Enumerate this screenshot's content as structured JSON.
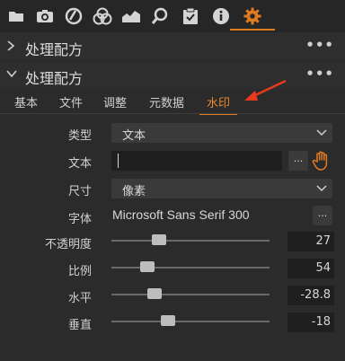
{
  "toolbar": {
    "icons": [
      "folder-icon",
      "camera-icon",
      "lens-icon",
      "color-icon",
      "exposure-icon",
      "search-icon",
      "clipboard-icon",
      "info-icon",
      "gear-icon"
    ],
    "active_color": "#e07b22"
  },
  "sections": [
    {
      "title": "处理配方",
      "expanded": false,
      "more": "•••"
    },
    {
      "title": "处理配方",
      "expanded": true,
      "more": "•••"
    }
  ],
  "tabs": [
    {
      "label": "基本"
    },
    {
      "label": "文件"
    },
    {
      "label": "调整"
    },
    {
      "label": "元数据"
    },
    {
      "label": "水印",
      "active": true
    }
  ],
  "watermark": {
    "type_label": "类型",
    "type_value": "文本",
    "text_label": "文本",
    "text_value": "",
    "text_more": "...",
    "size_label": "尺寸",
    "size_value": "像素",
    "font_label": "字体",
    "font_value": "Microsoft Sans Serif 300",
    "font_more": "...",
    "sliders": [
      {
        "label": "不透明度",
        "value": "27",
        "level": 0.3
      },
      {
        "label": "比例",
        "value": "54",
        "level": 0.23
      },
      {
        "label": "水平",
        "value": "-28.8",
        "level": 0.27
      },
      {
        "label": "垂直",
        "value": "-18",
        "level": 0.36
      }
    ]
  },
  "annotation_color": "#e8391f"
}
